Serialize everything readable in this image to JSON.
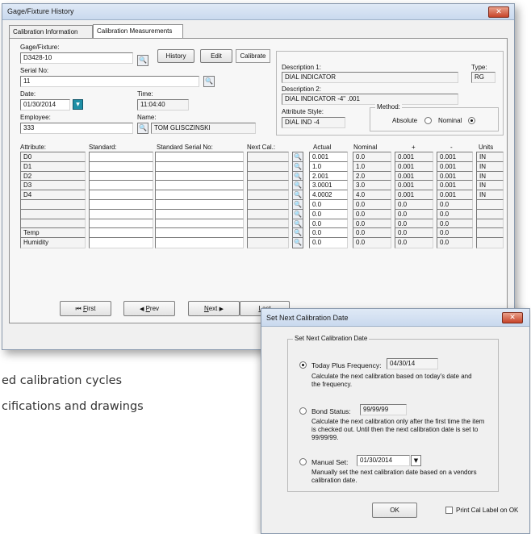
{
  "window": {
    "title": "Gage/Fixture History",
    "close_glyph": "✕"
  },
  "tabs": [
    "Calibration Information",
    "Calibration Measurements"
  ],
  "gage": {
    "label": "Gage/Fixture:",
    "value": "D3428-10"
  },
  "serial": {
    "label": "Serial No:",
    "value": "11"
  },
  "date": {
    "label": "Date:",
    "value": "01/30/2014"
  },
  "time": {
    "label": "Time:",
    "value": "11:04:40"
  },
  "employee": {
    "label": "Employee:",
    "value": "333"
  },
  "name": {
    "label": "Name:",
    "value": "TOM GLISCZINSKI"
  },
  "top_buttons": {
    "history": "History",
    "edit": "Edit",
    "calibrate": "Calibrate"
  },
  "description1": {
    "label": "Description 1:",
    "value": "DIAL INDICATOR"
  },
  "description2": {
    "label": "Description 2:",
    "value": "DIAL INDICATOR -4\" .001"
  },
  "type": {
    "label": "Type:",
    "value": "RG"
  },
  "attribute_style": {
    "label": "Attribute Style:",
    "value": "DIAL IND -4"
  },
  "method": {
    "label": "Method:",
    "absolute": "Absolute",
    "nominal": "Nominal",
    "selected": "Nominal"
  },
  "columns": {
    "attribute": "Attribute:",
    "standard": "Standard:",
    "standard_serial": "Standard Serial No:",
    "next_cal": "Next Cal.:",
    "actual": "Actual",
    "nominal": "Nominal",
    "plus": "+",
    "minus": "-",
    "units": "Units"
  },
  "rows": [
    {
      "attribute": "D0",
      "actual": "0.001",
      "nominal": "0.0",
      "plus": "0.001",
      "minus": "0.001",
      "units": "IN"
    },
    {
      "attribute": "D1",
      "actual": "1.0",
      "nominal": "1.0",
      "plus": "0.001",
      "minus": "0.001",
      "units": "IN"
    },
    {
      "attribute": "D2",
      "actual": "2.001",
      "nominal": "2.0",
      "plus": "0.001",
      "minus": "0.001",
      "units": "IN"
    },
    {
      "attribute": "D3",
      "actual": "3.0001",
      "nominal": "3.0",
      "plus": "0.001",
      "minus": "0.001",
      "units": "IN"
    },
    {
      "attribute": "D4",
      "actual": "4.0002",
      "nominal": "4.0",
      "plus": "0.001",
      "minus": "0.001",
      "units": "IN"
    },
    {
      "attribute": "",
      "actual": "0.0",
      "nominal": "0.0",
      "plus": "0.0",
      "minus": "0.0",
      "units": ""
    },
    {
      "attribute": "",
      "actual": "0.0",
      "nominal": "0.0",
      "plus": "0.0",
      "minus": "0.0",
      "units": ""
    },
    {
      "attribute": "",
      "actual": "0.0",
      "nominal": "0.0",
      "plus": "0.0",
      "minus": "0.0",
      "units": ""
    },
    {
      "attribute": "Temp",
      "actual": "0.0",
      "nominal": "0.0",
      "plus": "0.0",
      "minus": "0.0",
      "units": ""
    },
    {
      "attribute": "Humidity",
      "actual": "0.0",
      "nominal": "0.0",
      "plus": "0.0",
      "minus": "0.0",
      "units": ""
    }
  ],
  "nav": {
    "first": "First",
    "first_key": "F",
    "first_icon": "⏮",
    "prev": "Prev",
    "prev_key": "P",
    "prev_icon": "◀",
    "next": "Next",
    "next_key": "N",
    "next_icon": "▶",
    "last": "Last"
  },
  "icons": {
    "lookup": "magnifier-icon",
    "calendar": "dropdown-calendar-icon",
    "lookup_glyph": "🔍",
    "dropdown_glyph": "▼"
  },
  "captions": [
    "ed calibration cycles",
    "cifications and drawings"
  ],
  "dialog": {
    "title": "Set Next Calibration Date",
    "group_title": "Set Next Calibration Date",
    "today": {
      "label": "Today Plus Frequency:",
      "value": "04/30/14",
      "desc": "Calculate the next calibration based on today's date and the frequency."
    },
    "bond": {
      "label": "Bond Status:",
      "value": "99/99/99",
      "desc": "Calculate the next calibration only after the first time the item is checked out. Until then the next calibration date is set to 99/99/99."
    },
    "manual": {
      "label": "Manual Set:",
      "value": "01/30/2014",
      "desc": "Manually set the next calibration date based on a vendors calibration date."
    },
    "selected": "today",
    "ok": "OK",
    "print_label": "Print Cal Label on OK"
  },
  "colors": {
    "title_bar": "#c9d9ee",
    "close_button": "#c7442a",
    "calendar_button": "#1f8fa6"
  }
}
